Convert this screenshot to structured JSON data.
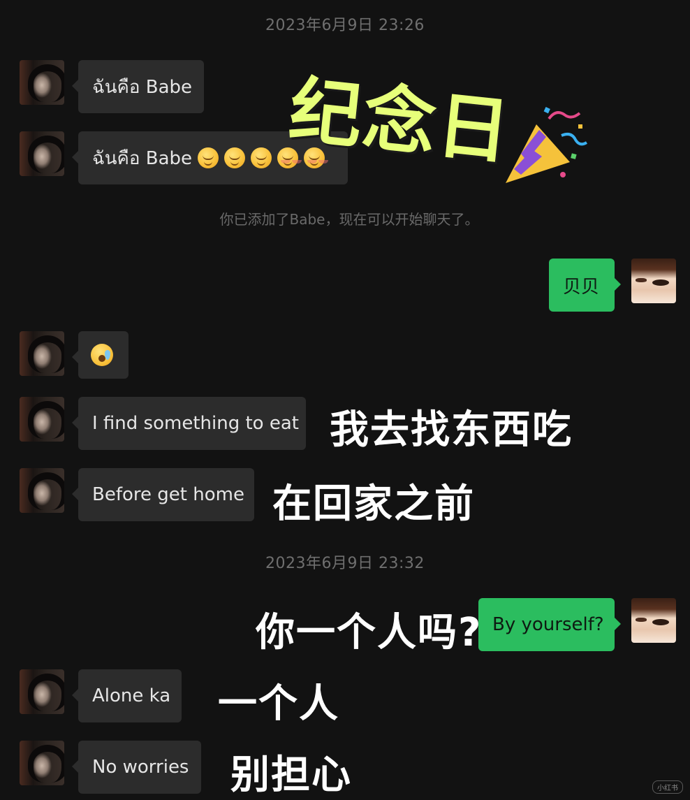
{
  "timestamps": [
    "2023年6月9日 23:26",
    "2023年6月9日 23:32"
  ],
  "system_note": "你已添加了Babe，现在可以开始聊天了。",
  "overlay_title": "纪念日",
  "messages": [
    {
      "text": "ฉันคือ Babe",
      "side": "left"
    },
    {
      "text": "ฉันคือ Babe",
      "side": "left",
      "emoji": [
        "smiling-face-icon",
        "smiling-face-icon",
        "smiling-face-icon",
        "blushing-face-icon",
        "blushing-face-icon"
      ]
    },
    {
      "text": "贝贝",
      "side": "right"
    },
    {
      "text": "",
      "side": "left",
      "emoji": [
        "crying-face-icon"
      ]
    },
    {
      "text": "I find something to eat",
      "side": "left",
      "caption": "我去找东西吃"
    },
    {
      "text": "Before get home",
      "side": "left",
      "caption": "在回家之前"
    },
    {
      "text": "By yourself?",
      "side": "right",
      "caption": "你一个人吗?"
    },
    {
      "text": "Alone ka",
      "side": "left",
      "caption": "一个人"
    },
    {
      "text": "No worries",
      "side": "left",
      "caption": "别担心"
    }
  ],
  "watermark": "小红书",
  "colors": {
    "background": "#121212",
    "bubble_received": "#2c2c2c",
    "bubble_sent": "#2bbd5f",
    "title_highlight": "#e7ff7a"
  }
}
